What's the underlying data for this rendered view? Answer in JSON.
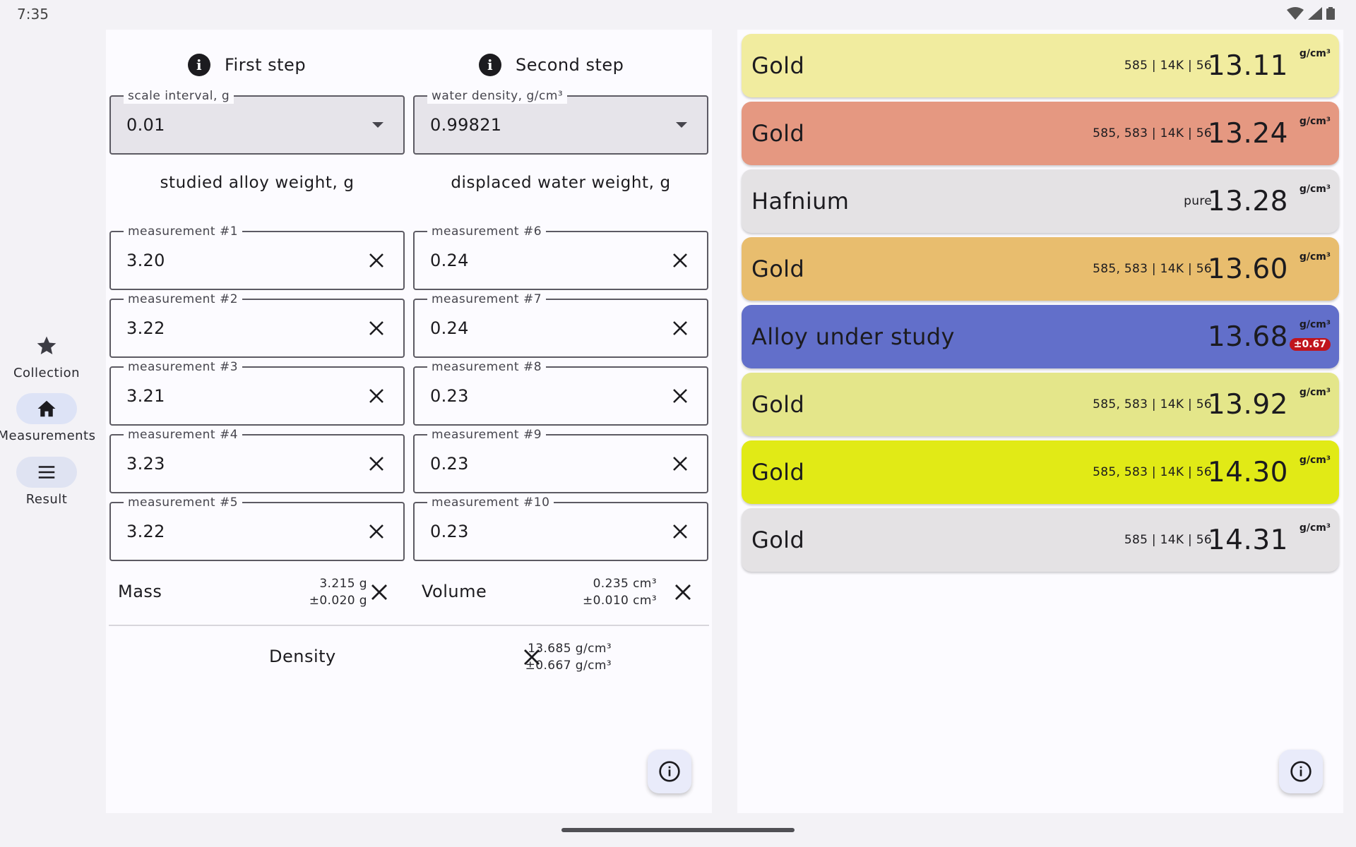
{
  "status": {
    "time": "7:35"
  },
  "nav": [
    {
      "label": "Collection",
      "icon": "star-icon"
    },
    {
      "label": "Measurements",
      "icon": "home-icon"
    },
    {
      "label": "Result",
      "icon": "menu-icon"
    }
  ],
  "left": {
    "first_step": "First step",
    "second_step": "Second step",
    "scale_interval": {
      "label": "scale interval, g",
      "value": "0.01"
    },
    "water_density": {
      "label": "water density, g/cm³",
      "value": "0.99821"
    },
    "alloy_title": "studied alloy weight, g",
    "water_title": "displaced water weight, g",
    "alloy_measurements": [
      {
        "label": "measurement #1",
        "value": "3.20"
      },
      {
        "label": "measurement #2",
        "value": "3.22"
      },
      {
        "label": "measurement #3",
        "value": "3.21"
      },
      {
        "label": "measurement #4",
        "value": "3.23"
      },
      {
        "label": "measurement #5",
        "value": "3.22"
      }
    ],
    "water_measurements": [
      {
        "label": "measurement #6",
        "value": "0.24"
      },
      {
        "label": "measurement #7",
        "value": "0.24"
      },
      {
        "label": "measurement #8",
        "value": "0.23"
      },
      {
        "label": "measurement #9",
        "value": "0.23"
      },
      {
        "label": "measurement #10",
        "value": "0.23"
      }
    ],
    "mass": {
      "label": "Mass",
      "value": "3.215 g",
      "error": "±0.020 g"
    },
    "volume": {
      "label": "Volume",
      "value": "0.235 cm³",
      "error": "±0.010 cm³"
    },
    "density": {
      "label": "Density",
      "value": "13.685 g/cm³",
      "error": "±0.667 g/cm³"
    }
  },
  "cards": [
    {
      "name": "Gold",
      "meta": "585 | 14K | 56",
      "density": "13.11",
      "unit": "g/cm³",
      "color": "#f1ec9f"
    },
    {
      "name": "Gold",
      "meta": "585, 583 | 14K | 56",
      "density": "13.24",
      "unit": "g/cm³",
      "color": "#e59881"
    },
    {
      "name": "Hafnium",
      "meta": "pure",
      "density": "13.28",
      "unit": "g/cm³",
      "color": "#e4e2e4"
    },
    {
      "name": "Gold",
      "meta": "585, 583 | 14K | 56",
      "density": "13.60",
      "unit": "g/cm³",
      "color": "#e8bd6e"
    },
    {
      "name": "Alloy under study",
      "meta": "",
      "density": "13.68",
      "unit": "g/cm³",
      "error": "±0.67",
      "color": "#626fca"
    },
    {
      "name": "Gold",
      "meta": "585, 583 | 14K | 56",
      "density": "13.92",
      "unit": "g/cm³",
      "color": "#e4e68a"
    },
    {
      "name": "Gold",
      "meta": "585, 583 | 14K | 56",
      "density": "14.30",
      "unit": "g/cm³",
      "color": "#e1ea16"
    },
    {
      "name": "Gold",
      "meta": "585 | 14K | 56",
      "density": "14.31",
      "unit": "g/cm³",
      "color": "#e4e2e4"
    }
  ]
}
